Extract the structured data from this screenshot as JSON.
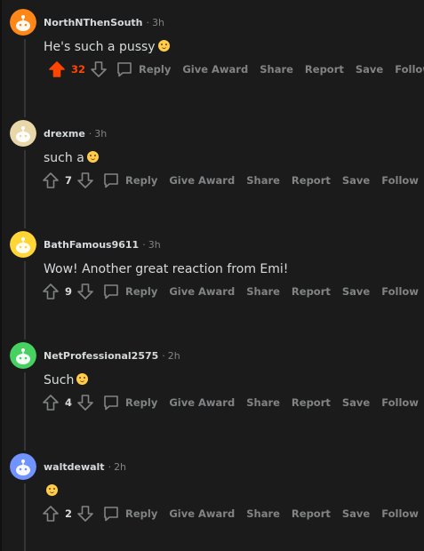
{
  "comments": [
    {
      "author": "NorthNThenSouth",
      "time": "3h",
      "text": "He's such a pussy",
      "emoji": "smirking-face",
      "votes": "32",
      "upvoted": true,
      "avatar_color": "#ff8717"
    },
    {
      "author": "drexme",
      "time": "3h",
      "text": "such a",
      "emoji": "smirking-face",
      "votes": "7",
      "upvoted": false,
      "avatar_color": "#e8d7a8"
    },
    {
      "author": "BathFamous9611",
      "time": "3h",
      "text": "Wow! Another great reaction from Emi!",
      "emoji": "",
      "votes": "9",
      "upvoted": false,
      "avatar_color": "#ffd635"
    },
    {
      "author": "NetProfessional2575",
      "time": "2h",
      "text": "Such",
      "emoji": "smirking-face",
      "votes": "4",
      "upvoted": false,
      "avatar_color": "#46d160"
    },
    {
      "author": "waltdewalt",
      "time": "2h",
      "text": "",
      "emoji": "smirking-face",
      "votes": "2",
      "upvoted": false,
      "avatar_color": "#7193ff"
    }
  ],
  "actions": {
    "reply": "Reply",
    "give_award": "Give Award",
    "share": "Share",
    "report": "Report",
    "save": "Save",
    "follow": "Follow"
  },
  "colors": {
    "background": "#1b1b1b",
    "upvote_active": "#ff4500",
    "muted": "#818384",
    "text": "#d7dadc"
  }
}
